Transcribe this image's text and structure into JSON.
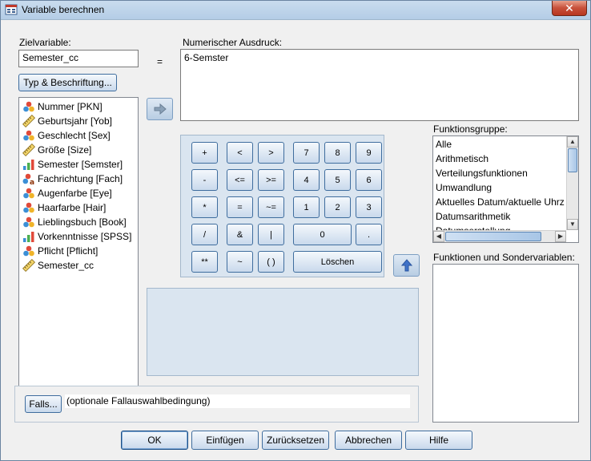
{
  "window": {
    "title": "Variable berechnen",
    "close_label": "✕"
  },
  "target": {
    "label": "Zielvariable:",
    "value": "Semester_cc",
    "type_button": "Typ & Beschriftung..."
  },
  "equals": "=",
  "expression": {
    "label": "Numerischer Ausdruck:",
    "value": "6-Semster"
  },
  "variables": [
    {
      "label": "Nummer [PKN]",
      "icon": "nominal-icon"
    },
    {
      "label": "Geburtsjahr [Yob]",
      "icon": "scale-icon"
    },
    {
      "label": "Geschlecht [Sex]",
      "icon": "nominal-icon"
    },
    {
      "label": "Größe [Size]",
      "icon": "scale-icon"
    },
    {
      "label": "Semester [Semster]",
      "icon": "ordinal-icon"
    },
    {
      "label": "Fachrichtung [Fach]",
      "icon": "nominal-string-icon"
    },
    {
      "label": "Augenfarbe [Eye]",
      "icon": "nominal-icon"
    },
    {
      "label": "Haarfarbe [Hair]",
      "icon": "nominal-icon"
    },
    {
      "label": "Lieblingsbuch [Book]",
      "icon": "nominal-icon"
    },
    {
      "label": "Vorkenntnisse [SPSS]",
      "icon": "ordinal-icon"
    },
    {
      "label": "Pflicht [Pflicht]",
      "icon": "nominal-icon"
    },
    {
      "label": "Semester_cc",
      "icon": "scale-icon"
    }
  ],
  "keypad": {
    "row1": [
      "+",
      "<",
      ">",
      "7",
      "8",
      "9"
    ],
    "row2": [
      "-",
      "<=",
      ">=",
      "4",
      "5",
      "6"
    ],
    "row3": [
      "*",
      "=",
      "~=",
      "1",
      "2",
      "3"
    ],
    "row4": [
      "/",
      "&",
      "|",
      "0",
      "."
    ],
    "row5": [
      "**",
      "~",
      "( )",
      "Löschen"
    ]
  },
  "function_group": {
    "label": "Funktionsgruppe:",
    "items": [
      "Alle",
      "Arithmetisch",
      "Verteilungsfunktionen",
      "Umwandlung",
      "Aktuelles Datum/aktuelle Uhrz",
      "Datumsarithmetik",
      "Datumserstellung"
    ]
  },
  "functions_label": "Funktionen und Sondervariablen:",
  "falls": {
    "button": "Falls...",
    "text": "(optionale Fallauswahlbedingung)"
  },
  "buttons": {
    "ok": "OK",
    "paste": "Einfügen",
    "reset": "Zurücksetzen",
    "cancel": "Abbrechen",
    "help": "Hilfe"
  }
}
